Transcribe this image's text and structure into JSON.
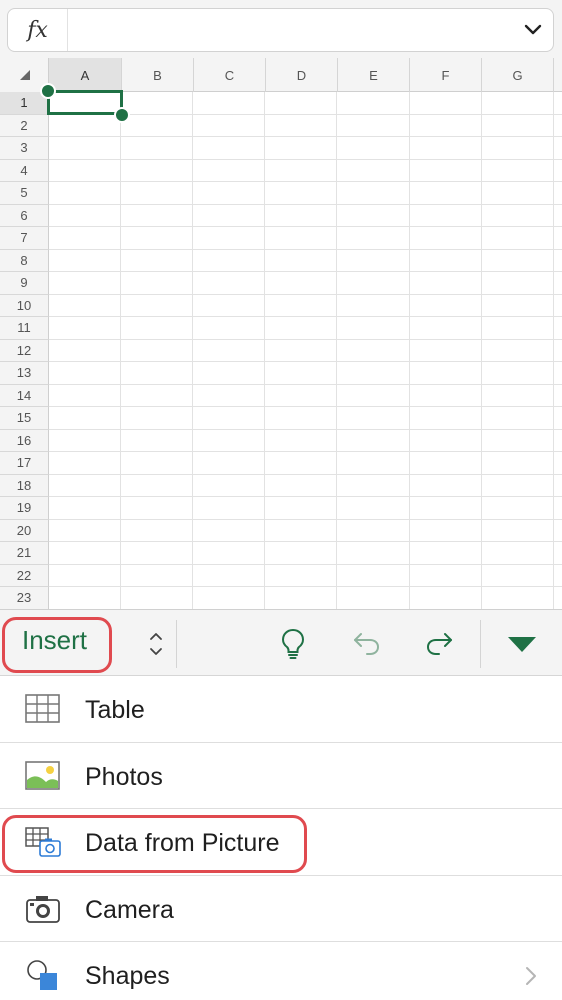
{
  "formula_bar": {
    "fx_label": "fx",
    "value": "",
    "icons": {
      "expand": "chevron-down-icon"
    }
  },
  "grid": {
    "columns": [
      "A",
      "B",
      "C",
      "D",
      "E",
      "F",
      "G"
    ],
    "rows": [
      "1",
      "2",
      "3",
      "4",
      "5",
      "6",
      "7",
      "8",
      "9",
      "10",
      "11",
      "12",
      "13",
      "14",
      "15",
      "16",
      "17",
      "18",
      "19",
      "20",
      "21",
      "22",
      "23"
    ],
    "selected_cell": "A1",
    "accent_color": "#1f7145"
  },
  "toolbar": {
    "tab_label": "Insert",
    "icons": [
      "switch-tab-icon",
      "lightbulb-icon",
      "undo-icon",
      "redo-icon",
      "collapse-triangle-icon"
    ]
  },
  "menu": {
    "items": [
      {
        "label": "Table",
        "icon": "table-icon"
      },
      {
        "label": "Photos",
        "icon": "photos-icon"
      },
      {
        "label": "Data from Picture",
        "icon": "data-from-picture-icon"
      },
      {
        "label": "Camera",
        "icon": "camera-icon"
      },
      {
        "label": "Shapes",
        "icon": "shapes-icon",
        "has_submenu": true
      }
    ]
  },
  "highlight_color": "#e04a4f"
}
